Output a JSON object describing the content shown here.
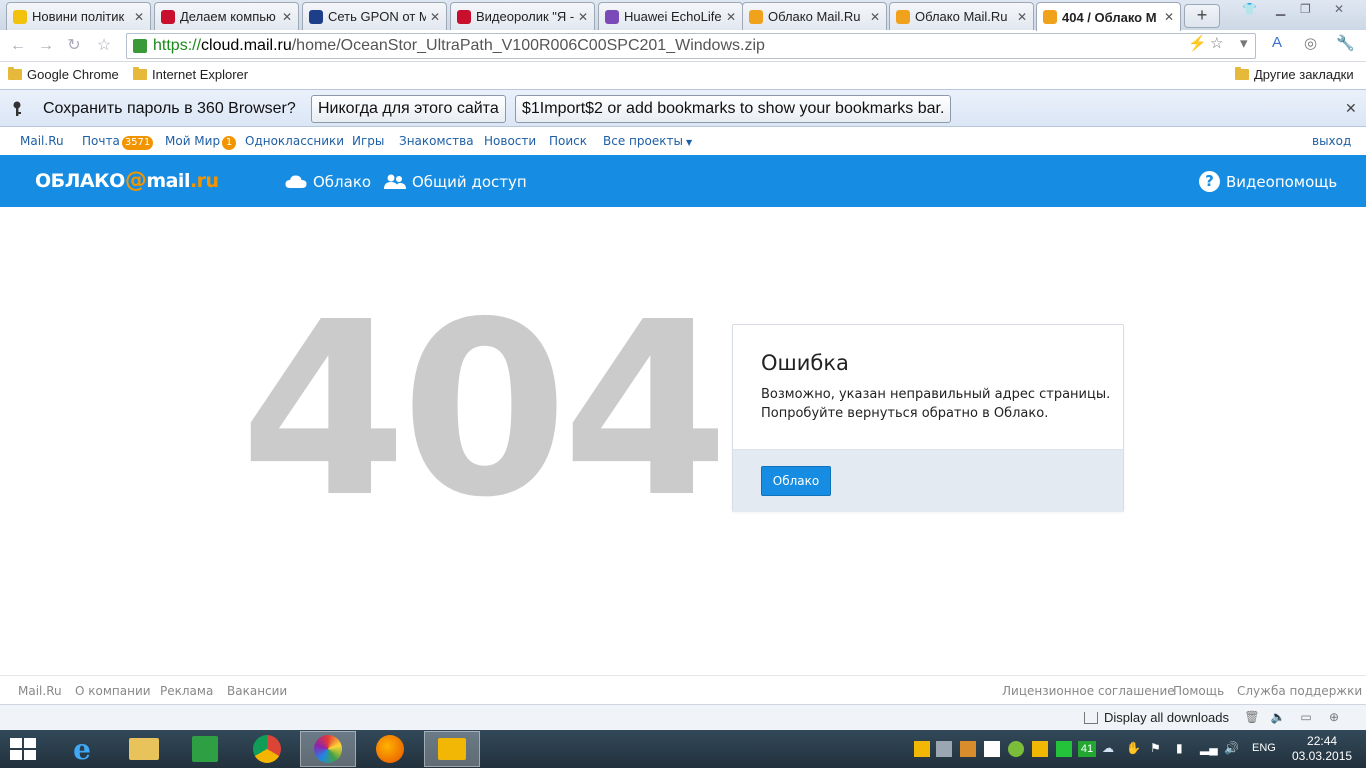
{
  "browser": {
    "tabs": [
      {
        "title": "Новини політик",
        "favicon_color": "#f3c20e"
      },
      {
        "title": "Делаем компью",
        "favicon_color": "#c8102e"
      },
      {
        "title": "Сеть GPON от М",
        "favicon_color": "#1d3f8a"
      },
      {
        "title": "Видеоролик \"Я -",
        "favicon_color": "#c8102e"
      },
      {
        "title": "Huawei EchoLife",
        "favicon_color": "#7a4bb8"
      },
      {
        "title": "Облако Mail.Ru",
        "favicon_color": "#f1a21c"
      },
      {
        "title": "Облако Mail.Ru",
        "favicon_color": "#f1a21c"
      },
      {
        "title": "404 / Облако М",
        "favicon_color": "#f1a21c"
      }
    ],
    "new_tab_label": "+",
    "url": {
      "scheme": "https://",
      "host": "cloud.mail.ru",
      "path": "/home/OceanStor_UltraPath_V100R006C00SPC201_Windows.zip"
    },
    "bookmarks": [
      "Google Chrome",
      "Internet Explorer"
    ],
    "other_bookmarks": "Другие закладки",
    "infobar": {
      "message": "Сохранить пароль в 360 Browser?",
      "button_never": "Никогда для этого сайта",
      "button_import": "$1Import$2 or add bookmarks to show your bookmarks bar."
    }
  },
  "portal": {
    "links": [
      "Mail.Ru",
      "Почта",
      "Мой Мир",
      "Одноклассники",
      "Игры",
      "Знакомства",
      "Новости",
      "Поиск",
      "Все проекты"
    ],
    "mail_badge": "3571",
    "mir_badge": "1",
    "logout": "выход"
  },
  "cloud_header": {
    "logo_left": "ОБЛАКО",
    "logo_at": "@",
    "logo_mail": "mail",
    "logo_ru": ".ru",
    "nav_cloud": "Облако",
    "nav_shared": "Общий доступ",
    "help": "Видеопомощь"
  },
  "error": {
    "code": "404",
    "title": "Ошибка",
    "line1": "Возможно, указан неправильный адрес страницы.",
    "line2": "Попробуйте вернуться обратно в Облако.",
    "button": "Облако"
  },
  "footer": {
    "left": [
      "Mail.Ru",
      "О компании",
      "Реклама",
      "Вакансии"
    ],
    "right": [
      "Лицензионное соглашение",
      "Помощь",
      "Служба поддержки"
    ]
  },
  "download_bar": {
    "label": "Display all downloads"
  },
  "taskbar": {
    "lang": "ENG",
    "time": "22:44",
    "date": "03.03.2015",
    "tray_counter": "41"
  },
  "colors": {
    "cloud_blue": "#168de2",
    "mail_orange": "#f29400",
    "code_gray": "#cbcbcb"
  }
}
